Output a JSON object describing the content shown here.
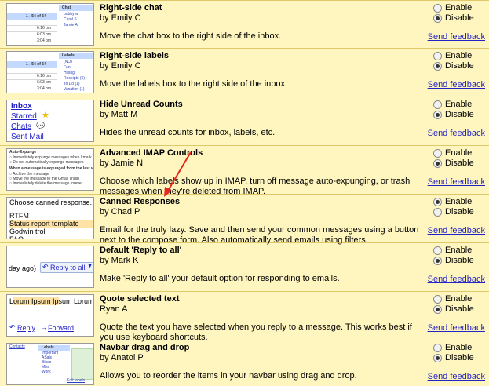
{
  "common": {
    "enable_label": "Enable",
    "disable_label": "Disable",
    "feedback_label": "Send feedback"
  },
  "colors": {
    "background": "#fff6bf",
    "link": "#2323c8",
    "arrow": "#e8261e"
  },
  "labs": [
    {
      "title": "Right-side chat",
      "author": "by Emily C",
      "description": "Move the chat box to the right side of the inbox.",
      "selected": "disable",
      "thumb": {
        "count": "1 - 54 of 54",
        "panel": "Chat",
        "times": [
          "6:16 pm",
          "6:03 pm",
          "3:04 pm"
        ],
        "names": [
          "bobby w",
          "Carol S",
          "Jamie A"
        ]
      }
    },
    {
      "title": "Right-side labels",
      "author": "by Emily C",
      "description": "Move the labels box to the right side of the inbox.",
      "selected": "disable",
      "thumb": {
        "count": "1 - 54 of 54",
        "panel": "Labels",
        "times": [
          "6:16 pm",
          "6:03 pm",
          "3:04 pm"
        ],
        "names": [
          "(NO)",
          "Fun",
          "Hiking",
          "Receipts (6)",
          "To Do (1)",
          "Vacation (1)"
        ]
      }
    },
    {
      "title": "Hide Unread Counts",
      "author": "by Matt M",
      "description": "Hides the unread counts for inbox, labels, etc.",
      "selected": "disable",
      "thumb": {
        "links": [
          "Inbox",
          "Starred",
          "Chats",
          "Sent Mail"
        ]
      }
    },
    {
      "title": "Advanced IMAP Controls",
      "author": "by Jamie N",
      "description": "Choose which labels show up in IMAP, turn off message auto-expunging, or trash messages when they're deleted from IMAP.",
      "selected": "disable",
      "thumb": {
        "heading1": "Auto-Expunge",
        "items1": [
          "Immediately expunge messages when I mark them",
          "Do not automatically expunge messages"
        ],
        "heading2": "When a message is expunged from the last visible",
        "items2": [
          "Archive the message",
          "Move the message to the Gmail Trash",
          "Immediately delete the message forever"
        ]
      }
    },
    {
      "title": "Canned Responses",
      "author": "by Chad P",
      "description": "Email for the truly lazy. Save and then send your common messages using a button next to the compose form. Also automatically send emails using filters.",
      "selected": "enable",
      "thumb": {
        "select": "Choose canned response...",
        "items": [
          "RTFM",
          "Status report template",
          "Godwin troll",
          "FAQ"
        ]
      }
    },
    {
      "title": "Default 'Reply to all'",
      "author": "by Mark K",
      "description": "Make 'Reply to all' your default option for responding to emails.",
      "selected": "disable",
      "thumb": {
        "left": "day ago)",
        "button": "Reply to all"
      }
    },
    {
      "title": "Quote selected text",
      "author": "Ryan A",
      "description": "Quote the text you have selected when you reply to a message. This works best if you use keyboard shortcuts.",
      "selected": "disable",
      "thumb": {
        "text": "Lorum Ipsum Ipsum Lorum I",
        "reply": "Reply",
        "forward": "Forward"
      }
    },
    {
      "title": "Navbar drag and drop",
      "author": "by Anatol P",
      "description": "Allows you to reorder the items in your navbar using drag and drop.",
      "selected": "disable",
      "thumb": {
        "contacts": "Contacts",
        "panel": "Labels",
        "items": [
          "Important",
          "ASals",
          "Bikes",
          "Misc",
          "Work"
        ],
        "edit": "Edit labels"
      }
    }
  ]
}
